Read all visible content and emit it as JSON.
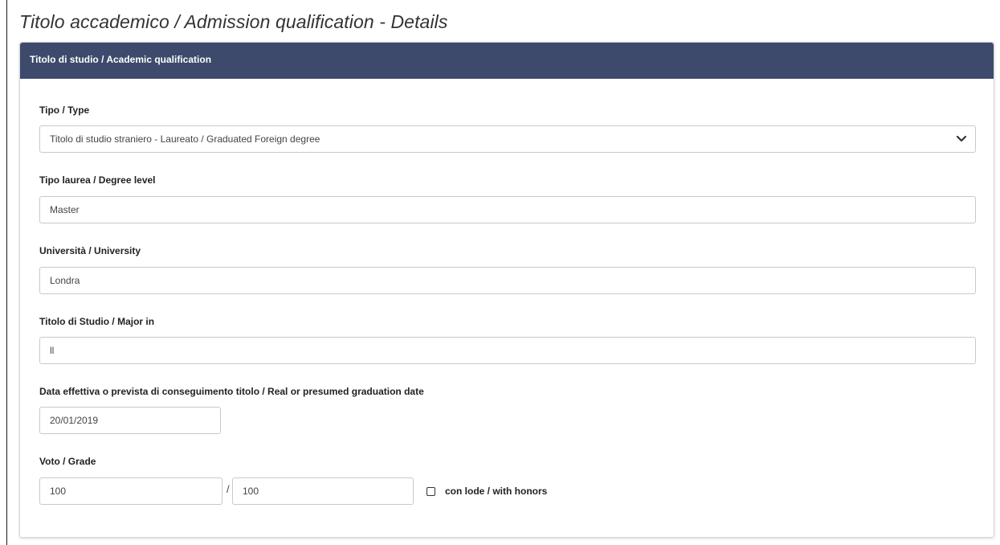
{
  "page": {
    "title": "Titolo accademico / Admission qualification - Details"
  },
  "panel": {
    "header": "Titolo di studio / Academic qualification"
  },
  "fields": {
    "type": {
      "label": "Tipo / Type",
      "value": "Titolo di studio straniero - Laureato / Graduated Foreign degree"
    },
    "degree_level": {
      "label": "Tipo laurea / Degree level",
      "value": "Master"
    },
    "university": {
      "label": "Università / University",
      "value": "Londra"
    },
    "major": {
      "label": "Titolo di Studio / Major in",
      "value": "ll"
    },
    "graduation_date": {
      "label": "Data effettiva o prevista di conseguimento titolo / Real or presumed graduation date",
      "value": "20/01/2019"
    },
    "grade": {
      "label": "Voto / Grade",
      "value": "100",
      "separator": "/",
      "max_value": "100",
      "honors_label": "con lode / with honors",
      "honors_checked": false
    }
  },
  "icons": {
    "select": "chevron-down-icon"
  },
  "colors": {
    "header_bg": "#3d4a6b",
    "header_text": "#ffffff",
    "field_border": "#c9c9c9"
  }
}
